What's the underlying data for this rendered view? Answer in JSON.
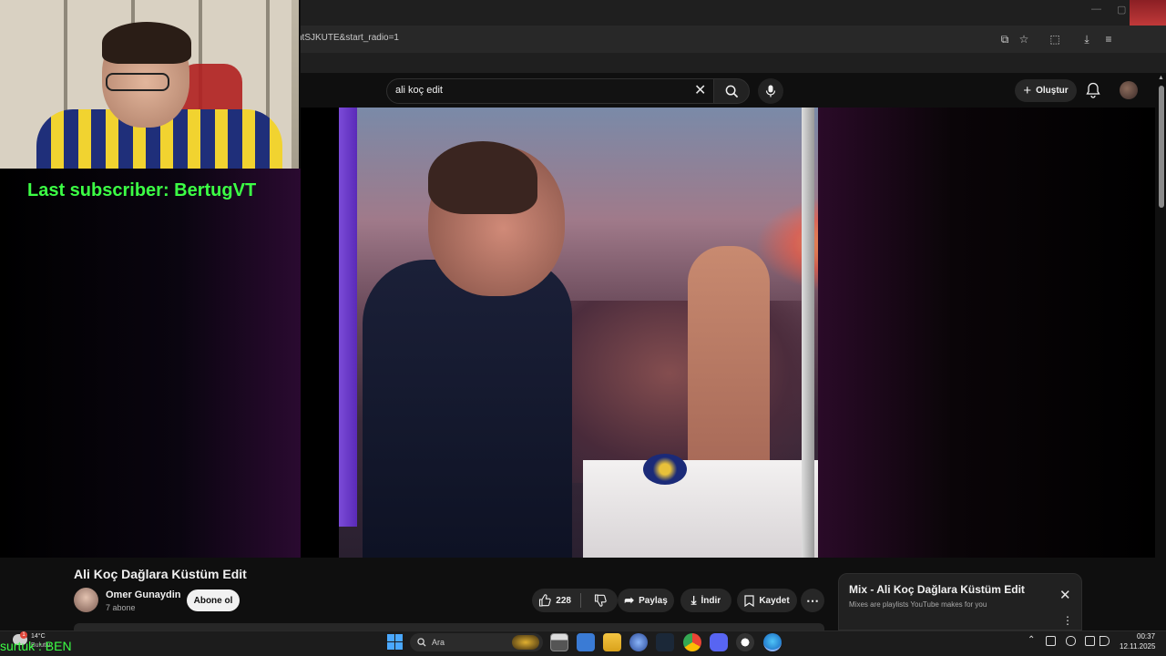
{
  "browser": {
    "url_fragment": "ntSJKUTE&start_radio=1"
  },
  "webcam_overlay": {
    "last_subscriber": "Last subscriber: BertugVT",
    "bottom_text": "surtuk : BEN"
  },
  "yt_header": {
    "search_query": "ali koç edit",
    "create_label": "Oluştur"
  },
  "video": {
    "title": "Ali Koç Dağlara Küstüm Edit",
    "channel_name": "Omer Gunaydin",
    "subscribers": "7 abone",
    "subscribe_label": "Abone ol",
    "likes": "228",
    "share_label": "Paylaş",
    "download_label": "İndir",
    "save_label": "Kaydet"
  },
  "mix_panel": {
    "title": "Mix - Ali Koç Dağlara Küstüm Edit",
    "subtitle": "Mixes are playlists YouTube makes for you"
  },
  "taskbar": {
    "weather_temp": "14°C",
    "weather_badge": "1",
    "weather_condition": "Bulutlu",
    "search_placeholder": "Ara",
    "clock_time": "00:37",
    "clock_date": "12.11.2025"
  },
  "colors": {
    "overlay_green": "#3cff45",
    "yt_bg": "#0f0f0f",
    "pill_bg": "#272727"
  }
}
